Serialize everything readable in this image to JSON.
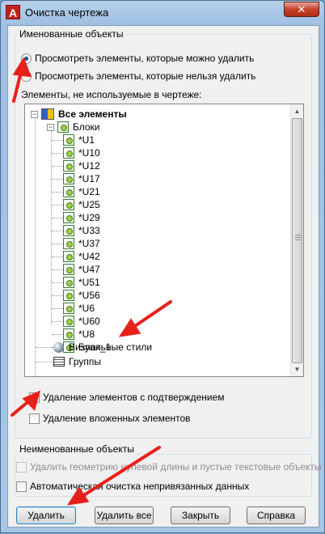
{
  "window": {
    "title": "Очистка чертежа",
    "app_icon_letter": "A",
    "close_glyph": "✕"
  },
  "named_objects": {
    "legend": "Именованные объекты",
    "radio_purgeable": "Просмотреть элементы, которые можно удалить",
    "radio_nonpurgeable": "Просмотреть элементы, которые нельзя удалить",
    "selected_radio": "purgeable",
    "tree_caption": "Элементы, не используемые в чертеже:"
  },
  "tree": {
    "root": "Все элементы",
    "blocks_label": "Блоки",
    "blocks": [
      "*U1",
      "*U10",
      "*U12",
      "*U17",
      "*U21",
      "*U25",
      "*U29",
      "*U33",
      "*U37",
      "*U42",
      "*U47",
      "*U51",
      "*U56",
      "*U6",
      "*U60",
      "*U8",
      "Блок_1"
    ],
    "visual_styles": "Визуальные стили",
    "groups": "Группы",
    "expander_collapsed": "+",
    "expander_expanded": "−"
  },
  "options": {
    "confirm_label": "Удаление элементов с подтверждением",
    "confirm_checked": true,
    "nested_label": "Удаление вложенных элементов",
    "nested_checked": false,
    "check_glyph": "✓"
  },
  "unnamed_objects": {
    "legend": "Неименованные объекты",
    "zero_length_label": "Удалить геометрию нулевой длины и пустые текстовые объекты",
    "orphan_data_label": "Автоматическая очистка непривязанных данных"
  },
  "buttons": {
    "purge": "Удалить",
    "purge_all": "Удалить все",
    "close": "Закрыть",
    "help": "Справка"
  },
  "colors": {
    "annotation_arrow": "#e8201a",
    "accent": "#1c4f9c"
  }
}
